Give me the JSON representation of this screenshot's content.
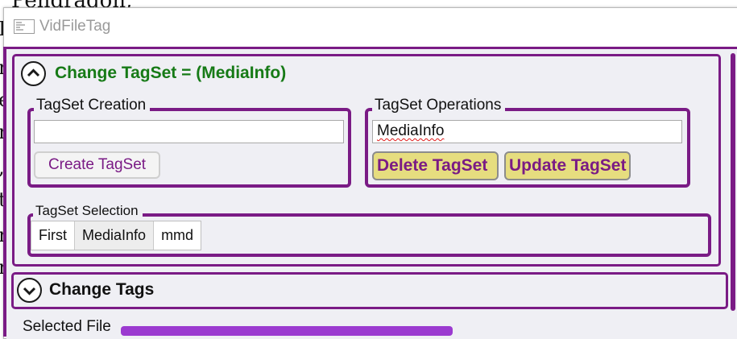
{
  "background_document": {
    "top_text": "Pendragon,",
    "left_chars": [
      "I",
      "n",
      "e",
      "r",
      ",",
      "t",
      "r",
      "r"
    ]
  },
  "window": {
    "title": "VidFileTag",
    "app_icon": "app-window-icon"
  },
  "tagset_expander": {
    "title": "Change TagSet = (MediaInfo)",
    "toggle_icon": "chevron-up-icon",
    "creation_group": {
      "label": "TagSet Creation",
      "input_value": "",
      "create_button": "Create TagSet"
    },
    "operations_group": {
      "label": "TagSet Operations",
      "input_value": "MediaInfo",
      "delete_button": "Delete TagSet",
      "update_button": "Update TagSet"
    },
    "selection_group": {
      "label": "TagSet Selection",
      "items": [
        "First",
        "MediaInfo",
        "mmd"
      ],
      "selected": "MediaInfo"
    }
  },
  "tags_expander": {
    "title": "Change Tags",
    "toggle_icon": "chevron-down-icon"
  },
  "selected_file": {
    "label": "Selected File"
  },
  "colors": {
    "accent_purple": "#7a1b85",
    "title_green": "#167a16",
    "button_yellow": "#e6dd7f",
    "panel_bg": "#efeff4"
  }
}
